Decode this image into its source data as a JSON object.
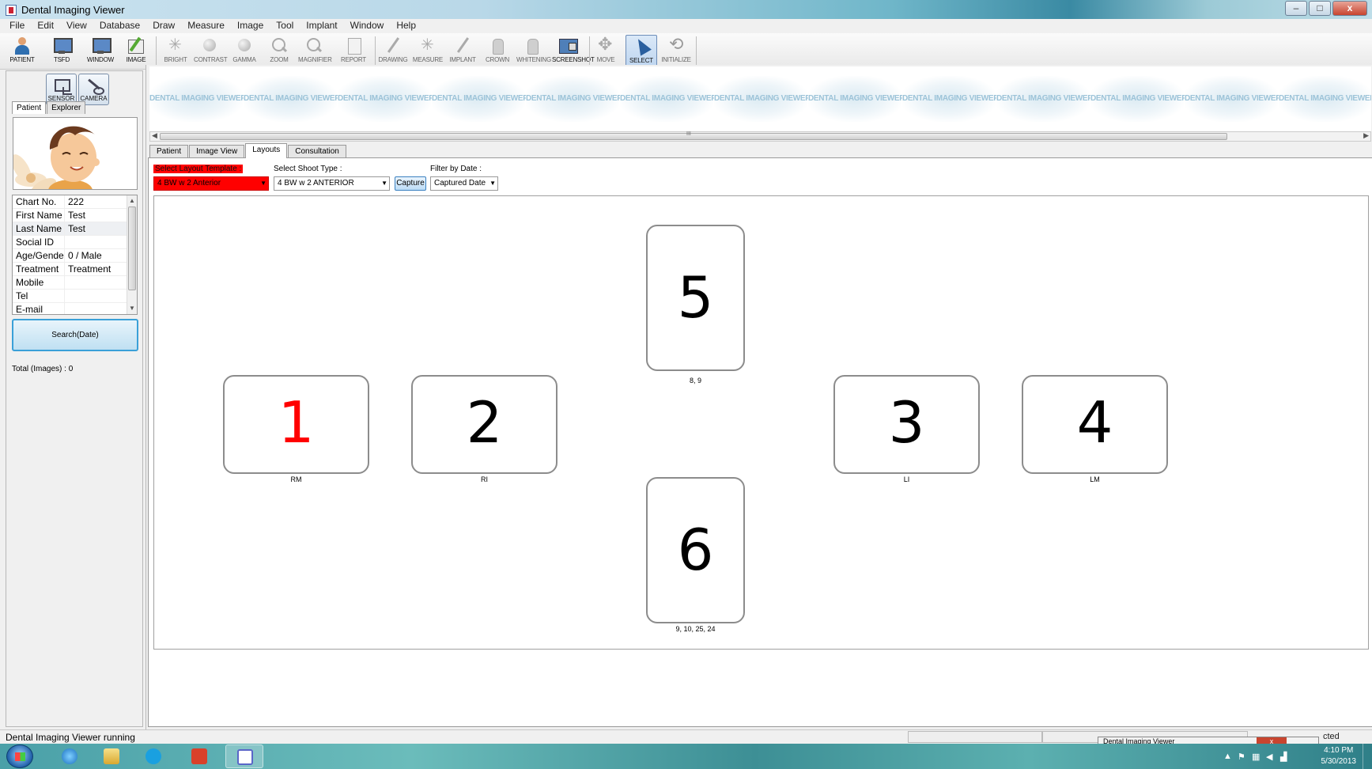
{
  "window": {
    "title": "Dental Imaging Viewer",
    "min": "–",
    "max": "□",
    "close": "x"
  },
  "menu": [
    "File",
    "Edit",
    "View",
    "Database",
    "Draw",
    "Measure",
    "Image",
    "Tool",
    "Implant",
    "Window",
    "Help"
  ],
  "toolbar": {
    "patient": "PATIENT",
    "tsfd": "TSFD",
    "window": "WINDOW",
    "image": "IMAGE",
    "bright": "BRIGHT",
    "contrast": "CONTRAST",
    "gamma": "GAMMA",
    "zoom": "ZOOM",
    "magnifier": "MAGNIFIER",
    "report": "REPORT",
    "drawing": "DRAWING",
    "measure": "MEASURE",
    "implant": "IMPLANT",
    "crown": "CROWN",
    "whitening": "WHITENING",
    "screenshot": "SCREENSHOT",
    "move": "MOVE",
    "select": "SELECT",
    "initialize": "INITIALIZE"
  },
  "left": {
    "sensor": "SENSOR",
    "camera": "CAMERA",
    "tabs": [
      "Patient",
      "Explorer"
    ],
    "info": [
      {
        "k": "Chart No.",
        "v": "222"
      },
      {
        "k": "First Name",
        "v": "Test"
      },
      {
        "k": "Last Name",
        "v": "Test"
      },
      {
        "k": "Social ID",
        "v": ""
      },
      {
        "k": "Age/Gender",
        "v": "0 / Male"
      },
      {
        "k": "Treatment",
        "v": "Treatment"
      },
      {
        "k": "Mobile",
        "v": ""
      },
      {
        "k": "Tel",
        "v": ""
      },
      {
        "k": "E-mail",
        "v": ""
      }
    ],
    "search": "Search(Date)",
    "total": "Total (Images) : 0"
  },
  "strip": {
    "watermark": "DENTAL IMAGING VIEWER",
    "scroll_mark": "III"
  },
  "tabs": [
    "Patient",
    "Image View",
    "Layouts",
    "Consultation"
  ],
  "layouts": {
    "template_label": "Select Layout Template :",
    "template_value": "4 BW w 2 Anterior",
    "shoot_label": "Select Shoot Type :",
    "shoot_value": "4 BW w 2 ANTERIOR",
    "capture": "Capture",
    "filter_label": "Filter by Date :",
    "filter_value": "Captured Date",
    "slots": [
      {
        "num": "1",
        "cap": "RM",
        "color": "#ff0000"
      },
      {
        "num": "2",
        "cap": "RI",
        "color": "#000000"
      },
      {
        "num": "5",
        "cap": "8, 9",
        "color": "#000000"
      },
      {
        "num": "3",
        "cap": "LI",
        "color": "#000000"
      },
      {
        "num": "4",
        "cap": "LM",
        "color": "#000000"
      },
      {
        "num": "6",
        "cap": "9, 10, 25, 24",
        "color": "#000000"
      }
    ]
  },
  "status": {
    "text": "Dental Imaging Viewer running",
    "right": "cted"
  },
  "taskbar": {
    "time": "4:10 PM",
    "date": "5/30/2013",
    "popup": "Dental Imaging Viewer"
  }
}
